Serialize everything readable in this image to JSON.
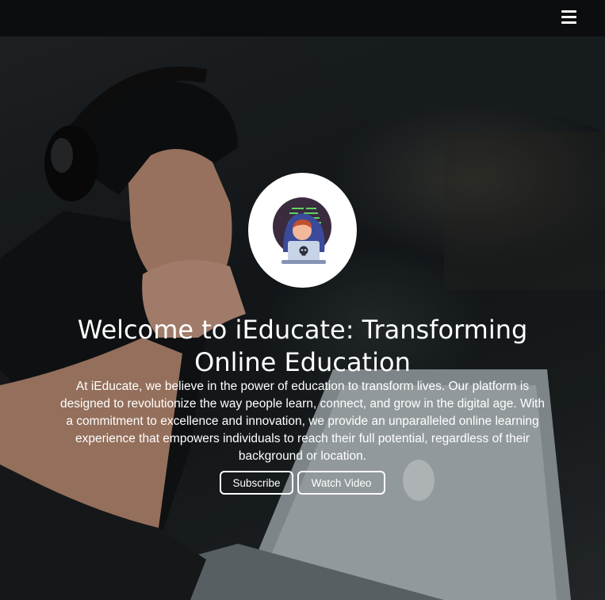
{
  "navbar": {
    "menu_icon": "hamburger-menu-icon"
  },
  "hero": {
    "background": "photo of a man wearing headphones looking at a laptop",
    "logo": "hooded coder at laptop illustration",
    "title_line1": "Welcome to iEducate: Transforming",
    "title_line2": "Online Education",
    "description": "At iEducate, we believe in the power of education to transform lives. Our platform is designed to revolutionize the way people learn, connect, and grow in the digital age. With a commitment to excellence and innovation, we provide an unparalleled online learning experience that empowers individuals to reach their full potential, regardless of their background or location.",
    "buttons": {
      "subscribe": "Subscribe",
      "watch_video": "Watch Video"
    }
  },
  "colors": {
    "navbar_bg": "#0b0d0f",
    "text": "#ffffff",
    "button_border": "#ffffff"
  }
}
